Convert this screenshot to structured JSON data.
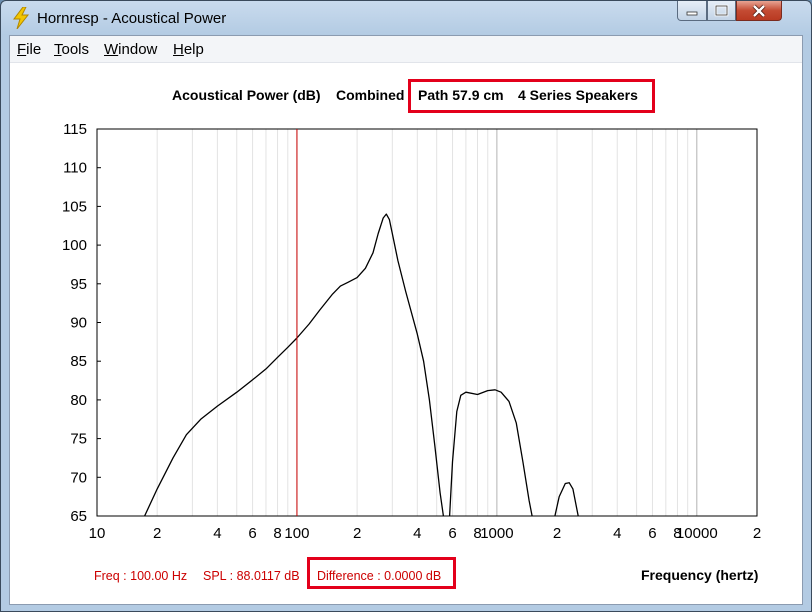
{
  "window": {
    "title": "Hornresp - Acoustical Power",
    "app_icon": "lightning-bolt-icon",
    "controls": [
      "minimize-icon",
      "maximize-icon",
      "close-icon"
    ]
  },
  "menu": {
    "file": "File",
    "tools": "Tools",
    "window": "Window",
    "help": "Help"
  },
  "header": {
    "chart_title": "Acoustical Power (dB)",
    "mode": "Combined",
    "path": "Path 57.9 cm",
    "speakers": "4 Series Speakers"
  },
  "status": {
    "freq": "Freq : 100.00 Hz",
    "spl": "SPL : 88.0117 dB",
    "difference": "Difference : 0.0000 dB",
    "xaxis_label": "Frequency (hertz)"
  },
  "colors": {
    "highlight": "#e3001b",
    "cursor": "#cc0000",
    "status_text": "#cc0000"
  },
  "chart_data": {
    "type": "line",
    "title": "Acoustical Power (dB)",
    "xlabel": "Frequency (hertz)",
    "ylabel": "",
    "xscale": "log",
    "xlim": [
      10,
      20000
    ],
    "ylim": [
      65,
      115
    ],
    "grid": true,
    "yticks": [
      "115",
      "110",
      "105",
      "100",
      "95",
      "90",
      "85",
      "80",
      "75",
      "70",
      "65"
    ],
    "xticks": [
      {
        "f": 10,
        "label": "10"
      },
      {
        "f": 20,
        "label": "2"
      },
      {
        "f": 40,
        "label": "4"
      },
      {
        "f": 60,
        "label": "6"
      },
      {
        "f": 80,
        "label": "8"
      },
      {
        "f": 100,
        "label": "100"
      },
      {
        "f": 200,
        "label": "2"
      },
      {
        "f": 400,
        "label": "4"
      },
      {
        "f": 600,
        "label": "6"
      },
      {
        "f": 800,
        "label": "8"
      },
      {
        "f": 1000,
        "label": "1000"
      },
      {
        "f": 2000,
        "label": "2"
      },
      {
        "f": 4000,
        "label": "4"
      },
      {
        "f": 6000,
        "label": "6"
      },
      {
        "f": 8000,
        "label": "8"
      },
      {
        "f": 10000,
        "label": "10000"
      },
      {
        "f": 20000,
        "label": "2"
      }
    ],
    "cursor_freq": 100,
    "series": [
      {
        "segments": [
          [
            [
              17.3,
              65
            ],
            [
              20,
              68.5
            ],
            [
              24,
              72.5
            ],
            [
              28,
              75.5
            ],
            [
              33,
              77.5
            ],
            [
              40,
              79.2
            ],
            [
              50,
              81
            ],
            [
              60,
              82.6
            ],
            [
              70,
              84
            ],
            [
              80,
              85.5
            ],
            [
              90,
              86.8
            ],
            [
              100,
              88
            ],
            [
              115,
              89.8
            ],
            [
              130,
              91.6
            ],
            [
              150,
              93.6
            ],
            [
              165,
              94.7
            ],
            [
              180,
              95.2
            ],
            [
              200,
              95.8
            ],
            [
              220,
              97
            ],
            [
              240,
              99
            ],
            [
              255,
              101.5
            ],
            [
              270,
              103.5
            ],
            [
              280,
              104
            ],
            [
              290,
              103.3
            ],
            [
              300,
              101.5
            ],
            [
              320,
              98
            ],
            [
              350,
              94
            ],
            [
              400,
              88.5
            ],
            [
              430,
              85
            ],
            [
              460,
              80
            ],
            [
              490,
              74
            ],
            [
              520,
              68
            ],
            [
              540,
              65
            ]
          ],
          [
            [
              580,
              65
            ],
            [
              600,
              72
            ],
            [
              630,
              78.5
            ],
            [
              660,
              80.6
            ],
            [
              700,
              81
            ],
            [
              800,
              80.7
            ],
            [
              900,
              81.2
            ],
            [
              980,
              81.3
            ],
            [
              1050,
              81
            ],
            [
              1150,
              79.8
            ],
            [
              1250,
              77
            ],
            [
              1350,
              72
            ],
            [
              1450,
              67
            ],
            [
              1500,
              65
            ]
          ],
          [
            [
              1950,
              65
            ],
            [
              2050,
              67.5
            ],
            [
              2200,
              69.2
            ],
            [
              2300,
              69.3
            ],
            [
              2400,
              68.5
            ],
            [
              2550,
              65
            ]
          ]
        ]
      }
    ]
  }
}
